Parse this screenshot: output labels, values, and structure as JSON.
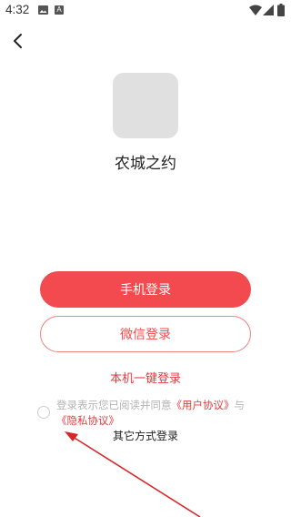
{
  "status_bar": {
    "time": "4:32",
    "notif_a": "A"
  },
  "login": {
    "app_name": "农城之约",
    "phone_login_label": "手机登录",
    "wechat_login_label": "微信登录",
    "one_click_label": "本机一键登录",
    "agreement_prefix": "登录表示您已阅读并同意",
    "user_agreement_link": "《用户协议》",
    "agreement_and": "与",
    "privacy_link": "《隐私协议》",
    "other_methods_label": "其它方式登录"
  },
  "colors": {
    "accent": "#f24a4f",
    "link": "#e43a3f",
    "annotation_arrow": "#d9262b"
  },
  "icons": [
    "image-icon",
    "a-notification-icon",
    "wifi-icon",
    "signal-icon",
    "battery-icon",
    "back-arrow-icon",
    "annotation-arrow-icon"
  ]
}
